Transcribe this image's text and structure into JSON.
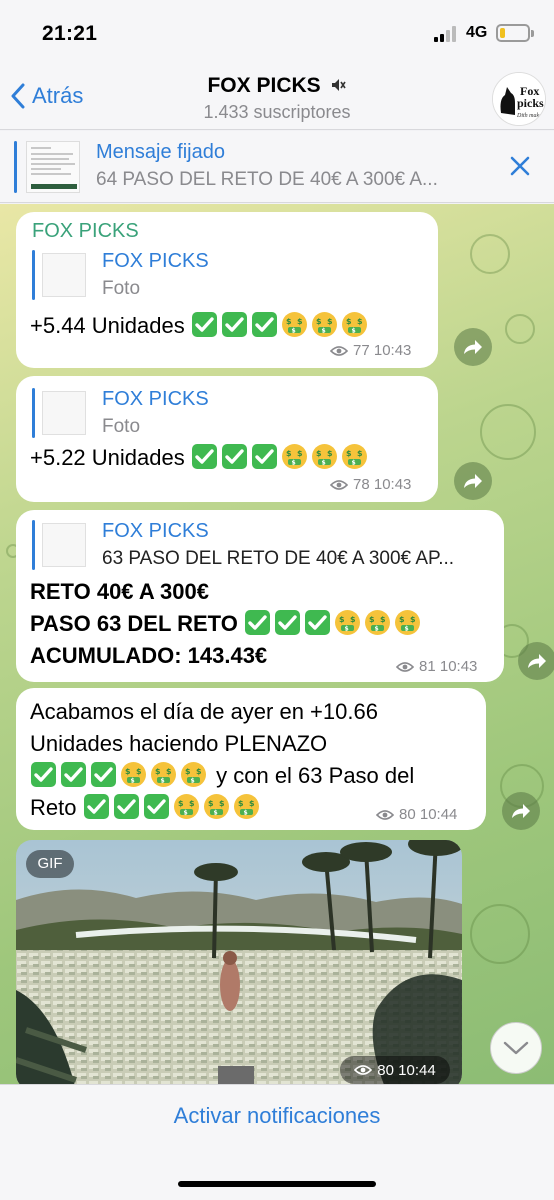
{
  "status_bar": {
    "time": "21:21",
    "network": "4G",
    "battery_level": 0.2
  },
  "nav": {
    "back_label": "Atrás",
    "title": "FOX PICKS",
    "subtitle": "1.433 suscriptores",
    "avatar_text": "Fox picks",
    "avatar_sub": "Dith makers"
  },
  "pinned": {
    "title": "Mensaje fijado",
    "text": "64 PASO DEL RETO DE 40€ A 300€ A..."
  },
  "messages": [
    {
      "sender": "FOX PICKS",
      "reply_name": "FOX PICKS",
      "reply_text": "Foto",
      "text": "+5.44 Unidades",
      "views": "77",
      "time": "10:43"
    },
    {
      "reply_name": "FOX PICKS",
      "reply_text": "Foto",
      "text": "+5.22 Unidades",
      "views": "78",
      "time": "10:43"
    },
    {
      "reply_name": "FOX PICKS",
      "reply_text": "63 PASO DEL RETO DE 40€ A 300€ AP...",
      "lines": [
        "RETO 40€ A 300€",
        "PASO 63 DEL RETO",
        "ACUMULADO: 143.43€"
      ],
      "views": "81",
      "time": "10:43"
    },
    {
      "lines": [
        "Acabamos el día de ayer en +10.66",
        "Unidades haciendo PLENAZO",
        "y con el 63 Paso del",
        "Reto"
      ],
      "views": "80",
      "time": "10:44"
    },
    {
      "badge": "GIF",
      "views": "80",
      "time": "10:44"
    }
  ],
  "bottom": {
    "action_label": "Activar notificaciones"
  },
  "colors": {
    "accent": "#2f7ed8",
    "sender": "#3aa27a",
    "check": "#3fb950"
  }
}
